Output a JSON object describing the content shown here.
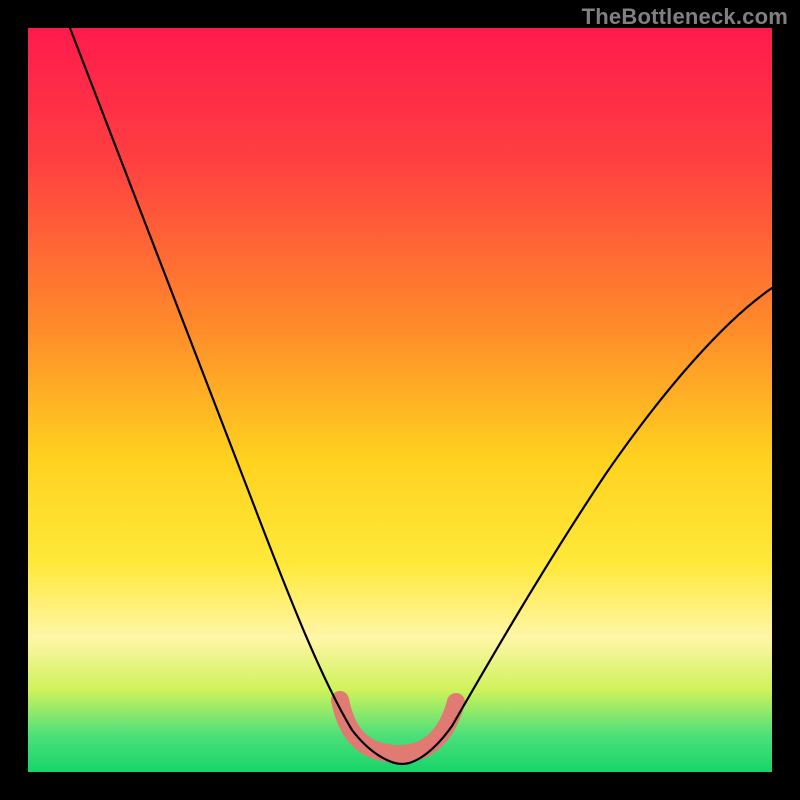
{
  "watermark": {
    "text": "TheBottleneck.com"
  },
  "chart_data": {
    "type": "line",
    "title": "",
    "xlabel": "",
    "ylabel": "",
    "xlim": [
      0,
      100
    ],
    "ylim": [
      0,
      100
    ],
    "grid": false,
    "legend": false,
    "background": {
      "type": "vertical-gradient",
      "stops": [
        {
          "pos": 0.0,
          "color": "#ff1a4d"
        },
        {
          "pos": 0.18,
          "color": "#ff4040"
        },
        {
          "pos": 0.4,
          "color": "#ff8a2b"
        },
        {
          "pos": 0.58,
          "color": "#ffd21f"
        },
        {
          "pos": 0.72,
          "color": "#ffe93a"
        },
        {
          "pos": 0.82,
          "color": "#fff6a8"
        },
        {
          "pos": 0.89,
          "color": "#cff25a"
        },
        {
          "pos": 0.95,
          "color": "#4de07a"
        },
        {
          "pos": 1.0,
          "color": "#16d46a"
        }
      ]
    },
    "series": [
      {
        "name": "bottleneck-curve",
        "color": "#000000",
        "width": 2.1,
        "x": [
          5,
          10,
          15,
          20,
          25,
          30,
          35,
          40,
          43,
          46,
          49,
          51,
          53,
          56,
          60,
          65,
          70,
          75,
          80,
          85,
          90,
          95,
          100
        ],
        "y": [
          100,
          88,
          76,
          64,
          53,
          42,
          31,
          20,
          12,
          6,
          3,
          2,
          3,
          6,
          12,
          20,
          28,
          35,
          42,
          48,
          54,
          59,
          63
        ]
      }
    ],
    "annotations": [
      {
        "name": "sweet-spot-zone",
        "shape": "u-band",
        "color": "#e07a72",
        "x_range": [
          42,
          57
        ],
        "y_range": [
          2,
          11
        ]
      }
    ]
  }
}
